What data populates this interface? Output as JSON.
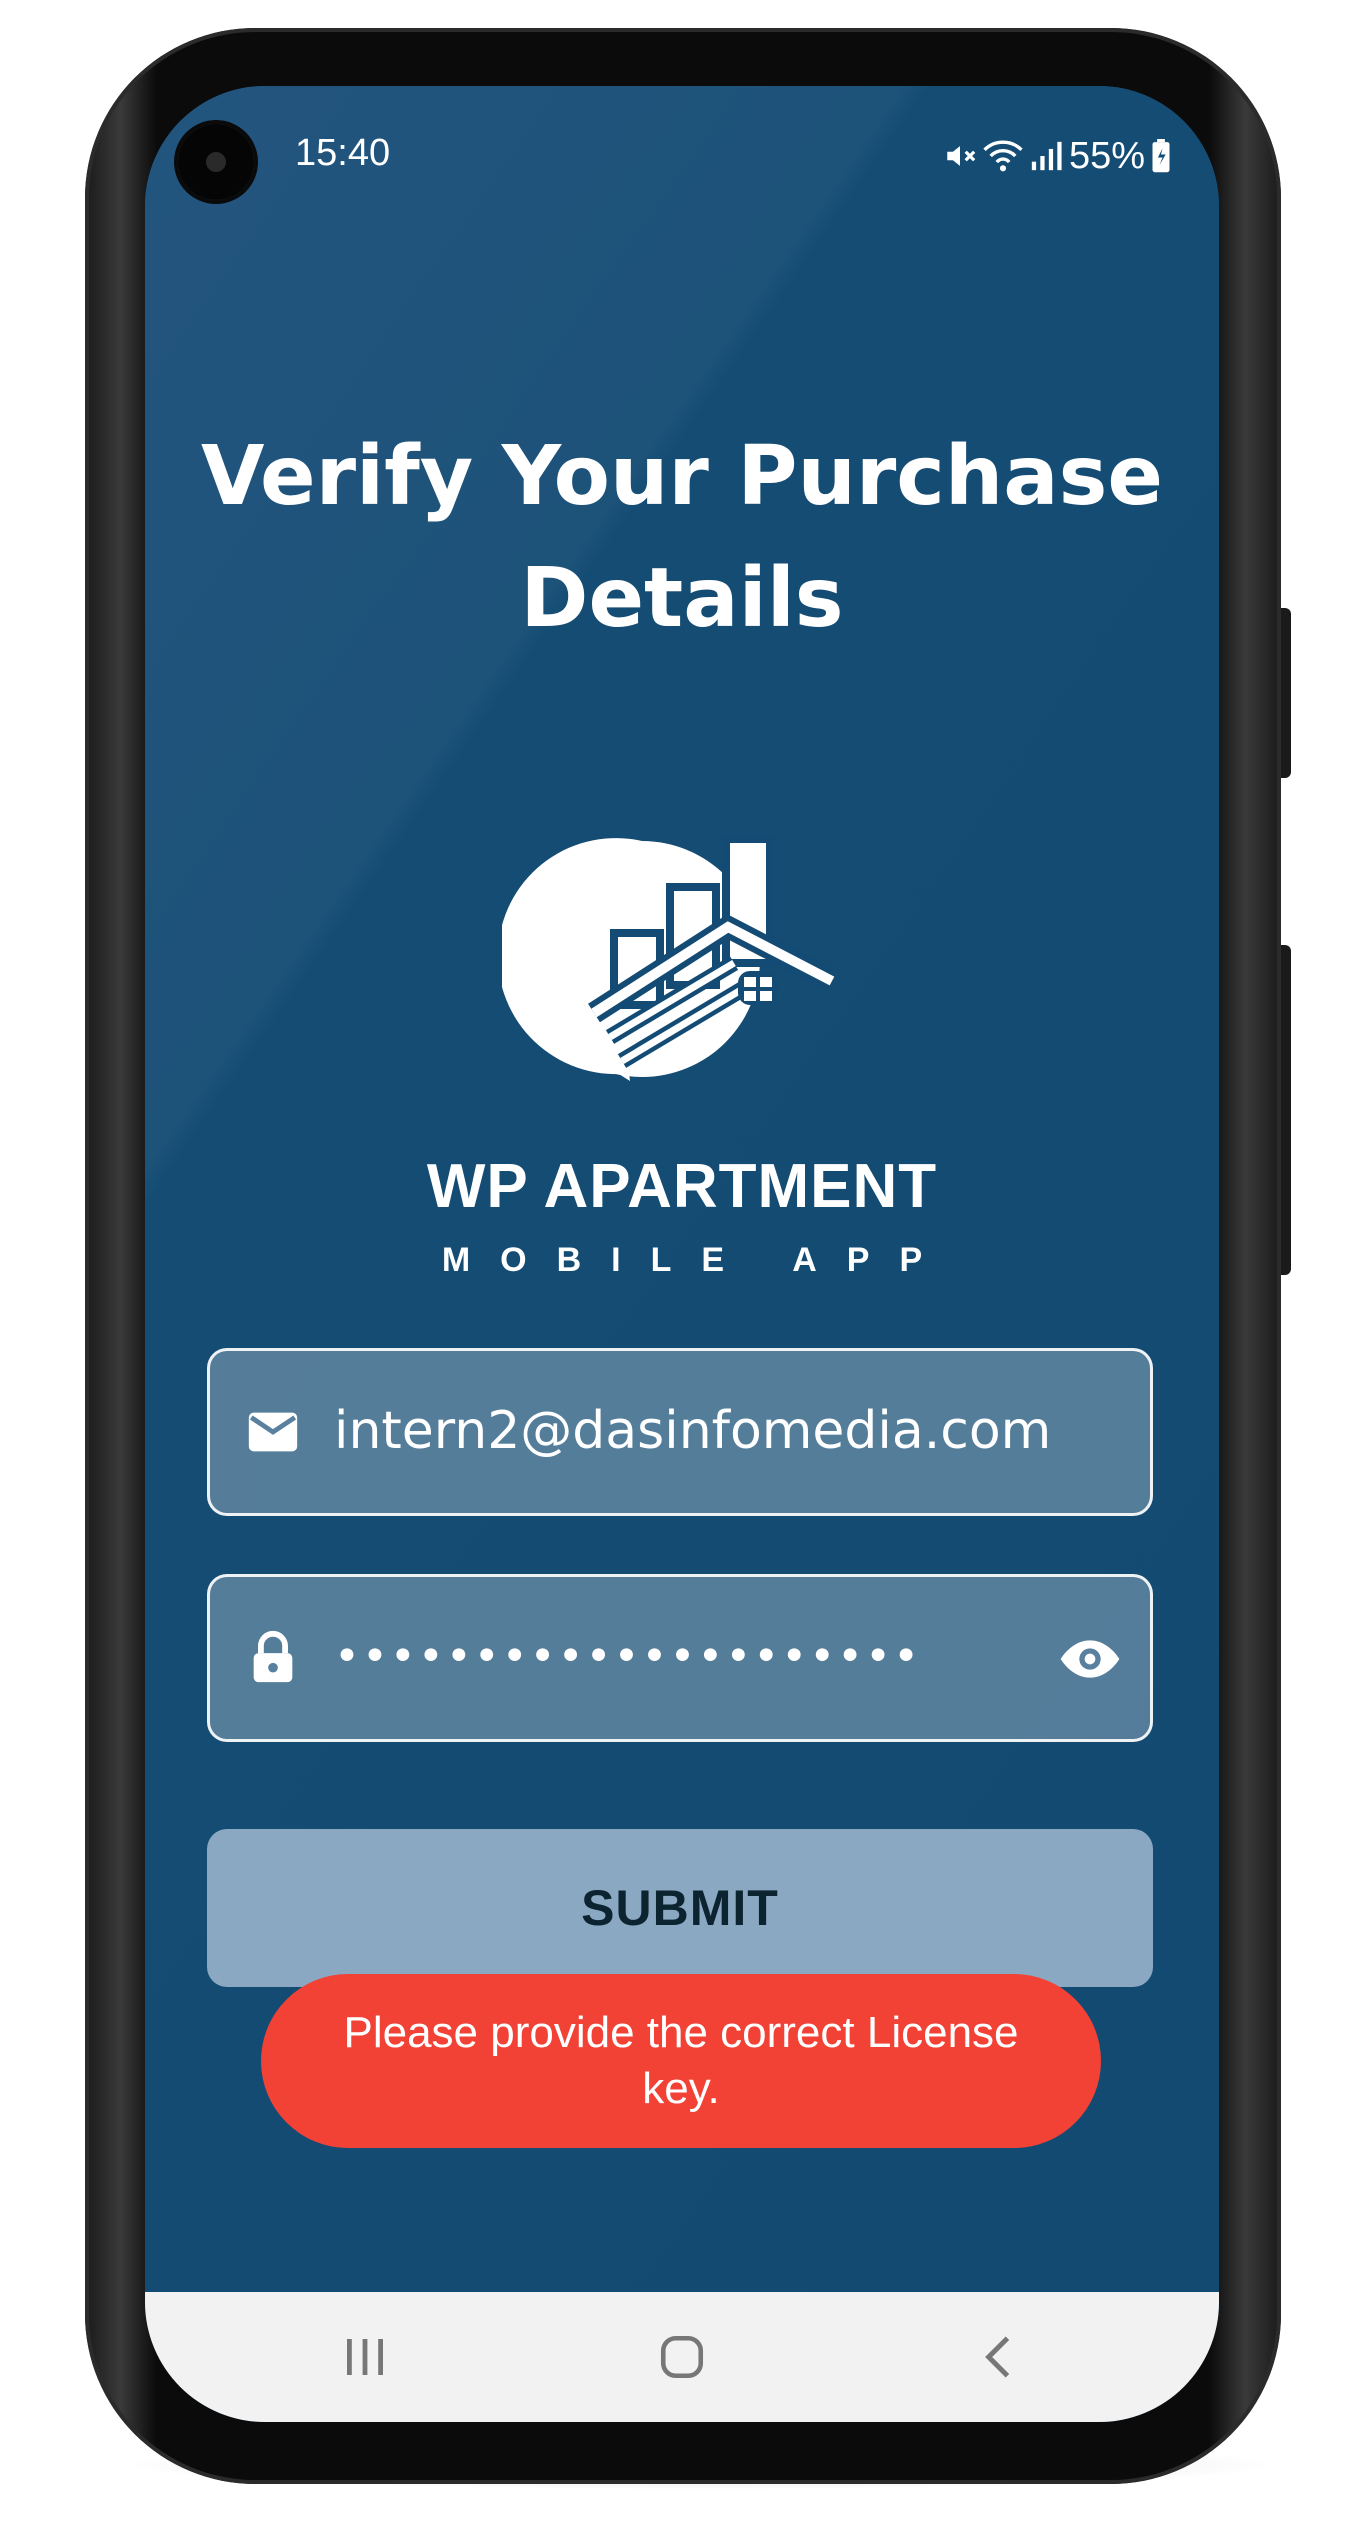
{
  "status_bar": {
    "time": "15:40",
    "battery": "55%",
    "icons": [
      "mute-icon",
      "wifi-icon",
      "signal-icon",
      "battery-icon"
    ]
  },
  "page": {
    "title": "Verify Your Purchase Details"
  },
  "brand": {
    "name": "WP APARTMENT",
    "subtitle": "MOBILE APP"
  },
  "form": {
    "email_value": "intern2@dasinfomedia.com",
    "password_value": "•••••••••••••••••••••",
    "submit_label": "SUBMIT"
  },
  "toast": {
    "message": "Please provide the correct License key."
  },
  "nav": {
    "icons": [
      "recent-apps-icon",
      "home-icon",
      "back-icon"
    ]
  },
  "colors": {
    "background": "#134b74",
    "field_bg": "#5a809f",
    "submit_bg": "#8aa8c2",
    "toast_bg": "#f24236"
  }
}
